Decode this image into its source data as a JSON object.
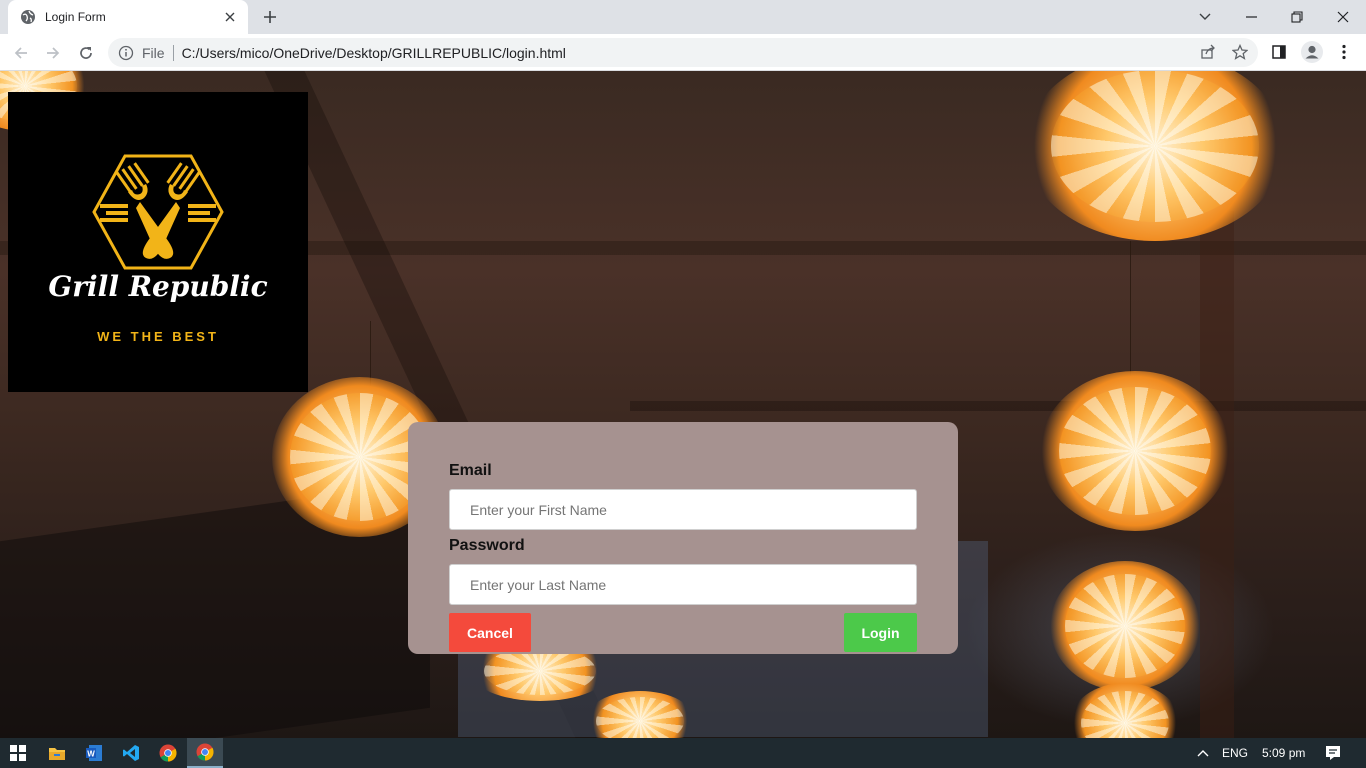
{
  "browser": {
    "tab_title": "Login Form",
    "url_scheme": "File",
    "url": "C:/Users/mico/OneDrive/Desktop/GRILLREPUBLIC/login.html"
  },
  "logo": {
    "name": "Grill Republic",
    "tagline": "WE THE BEST",
    "accent_color": "#f2b418",
    "icon": "crossed-forks-hexagon-icon"
  },
  "form": {
    "email_label": "Email",
    "email_placeholder": "Enter your First Name",
    "password_label": "Password",
    "password_placeholder": "Enter your Last Name",
    "cancel_label": "Cancel",
    "login_label": "Login",
    "card_color": "#a69290",
    "cancel_color": "#f44a3c",
    "login_color": "#4cc94a"
  },
  "taskbar": {
    "language": "ENG",
    "time": "5:09 pm",
    "apps": [
      "start-icon",
      "file-explorer-icon",
      "word-icon",
      "vscode-icon",
      "chrome-icon",
      "chrome-active-icon"
    ]
  }
}
